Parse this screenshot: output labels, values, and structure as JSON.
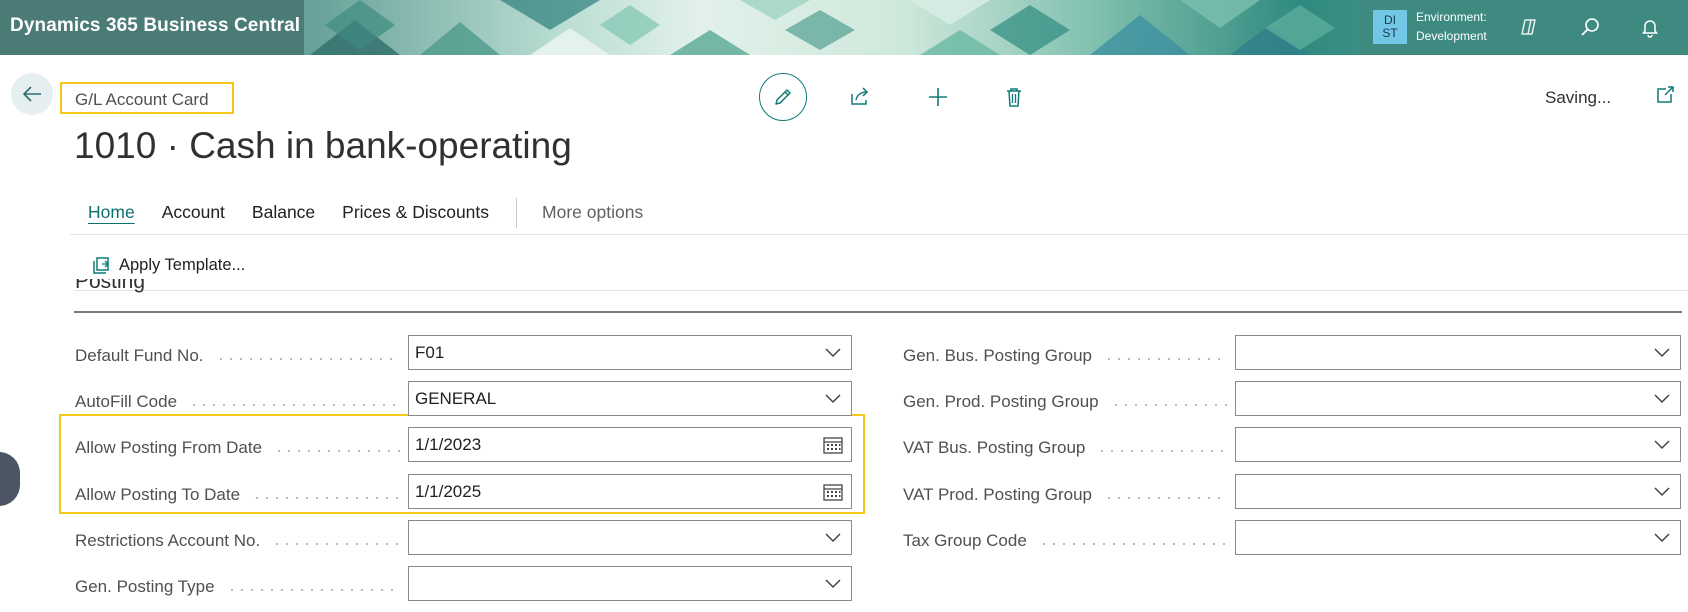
{
  "app": {
    "brand": "Dynamics 365 Business Central",
    "environment_badge_line1": "DI",
    "environment_badge_line2": "ST",
    "environment_label": "Environment:",
    "environment_name": "Development",
    "icons": [
      "copilot-icon",
      "search-icon",
      "bell-icon"
    ]
  },
  "page": {
    "caption": "G/L Account Card",
    "title": "1010 · Cash in bank-operating",
    "status": "Saving...",
    "header_icons": [
      "edit-icon",
      "share-icon",
      "plus-icon",
      "trash-icon",
      "open-in-new-icon"
    ]
  },
  "action_bar": {
    "tabs": [
      {
        "label": "Home",
        "active": true
      },
      {
        "label": "Account",
        "active": false
      },
      {
        "label": "Balance",
        "active": false
      },
      {
        "label": "Prices & Discounts",
        "active": false
      }
    ],
    "more_options": "More options",
    "apply_template": "Apply Template..."
  },
  "section": {
    "title": "Posting",
    "left_fields": [
      {
        "label": "Default Fund No.",
        "value": "F01",
        "control": "dropdown"
      },
      {
        "label": "AutoFill Code",
        "value": "GENERAL",
        "control": "dropdown"
      },
      {
        "label": "Allow Posting From Date",
        "value": "1/1/2023",
        "control": "date"
      },
      {
        "label": "Allow Posting To Date",
        "value": "1/1/2025",
        "control": "date"
      },
      {
        "label": "Restrictions Account No.",
        "value": "",
        "control": "dropdown"
      },
      {
        "label": "Gen. Posting Type",
        "value": "",
        "control": "dropdown"
      }
    ],
    "right_fields": [
      {
        "label": "Gen. Bus. Posting Group",
        "value": "",
        "control": "dropdown"
      },
      {
        "label": "Gen. Prod. Posting Group",
        "value": "",
        "control": "dropdown"
      },
      {
        "label": "VAT Bus. Posting Group",
        "value": "",
        "control": "dropdown"
      },
      {
        "label": "VAT Prod. Posting Group",
        "value": "",
        "control": "dropdown"
      },
      {
        "label": "Tax Group Code",
        "value": "",
        "control": "dropdown"
      }
    ]
  },
  "colors": {
    "accent": "#0f7b78",
    "highlight": "#f5c518",
    "badge": "#73c7e6"
  }
}
